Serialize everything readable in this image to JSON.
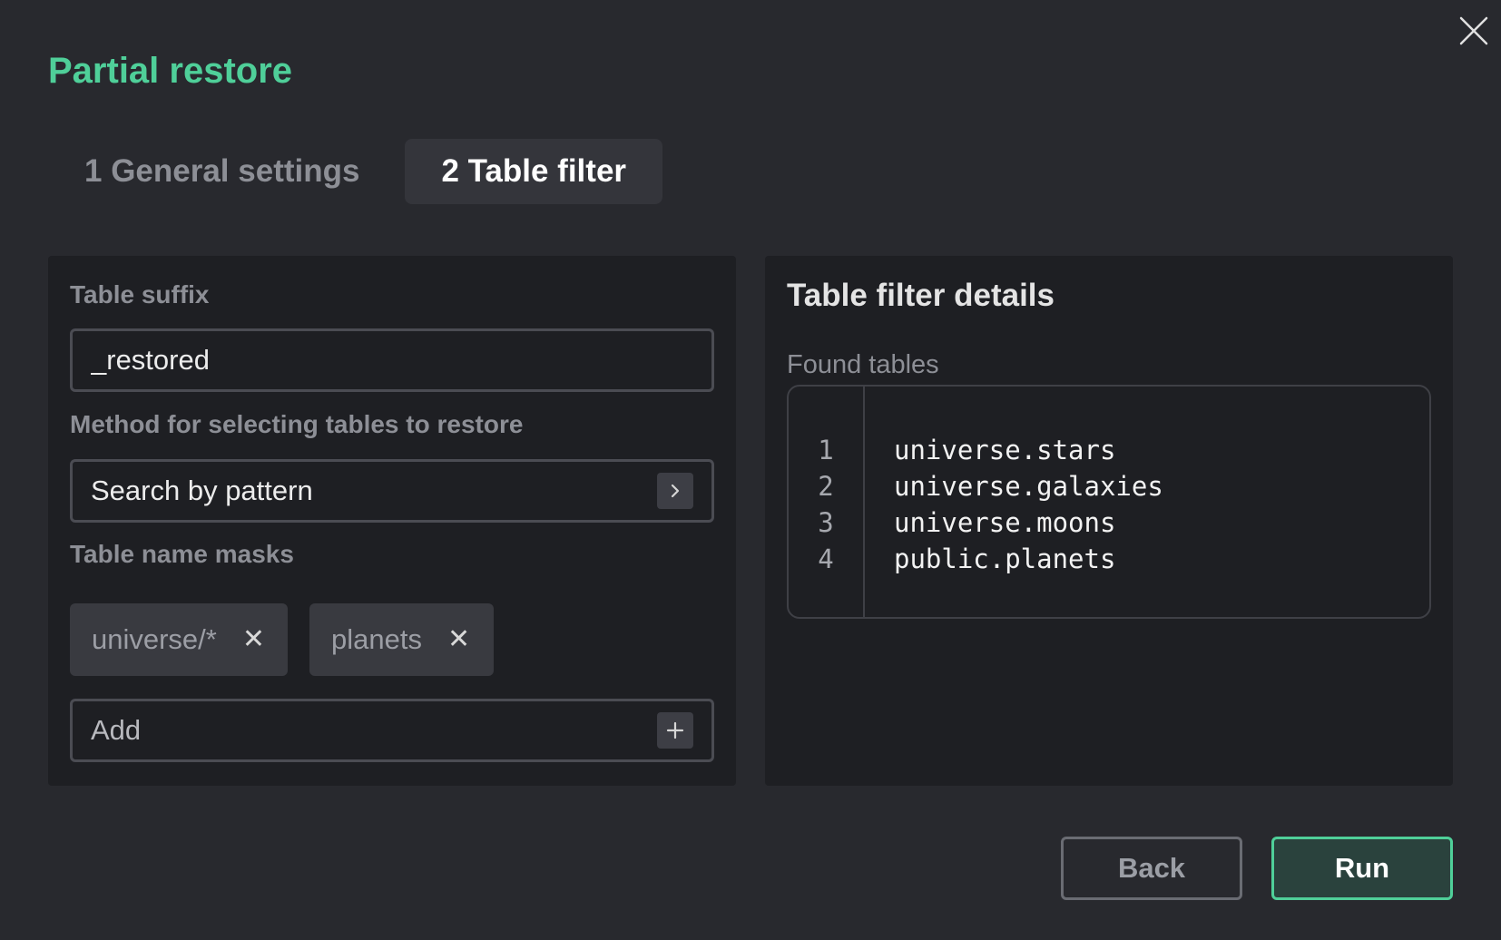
{
  "dialog": {
    "title": "Partial restore",
    "tabs": [
      {
        "label": "1 General settings",
        "active": false
      },
      {
        "label": "2 Table filter",
        "active": true
      }
    ]
  },
  "form": {
    "suffix_label": "Table suffix",
    "suffix_value": "_restored",
    "method_label": "Method for selecting tables to restore",
    "method_value": "Search by pattern",
    "masks_label": "Table name masks",
    "masks": [
      "universe/*",
      "planets"
    ],
    "add_placeholder": "Add"
  },
  "details": {
    "title": "Table filter details",
    "found_label": "Found tables",
    "line_numbers": [
      "1",
      "2",
      "3",
      "4"
    ],
    "tables": [
      "universe.stars",
      "universe.galaxies",
      "universe.moons",
      "public.planets"
    ]
  },
  "actions": {
    "back_label": "Back",
    "run_label": "Run"
  },
  "colors": {
    "accent": "#4fcf99",
    "background": "#28292e",
    "panel": "#1e1f23"
  }
}
